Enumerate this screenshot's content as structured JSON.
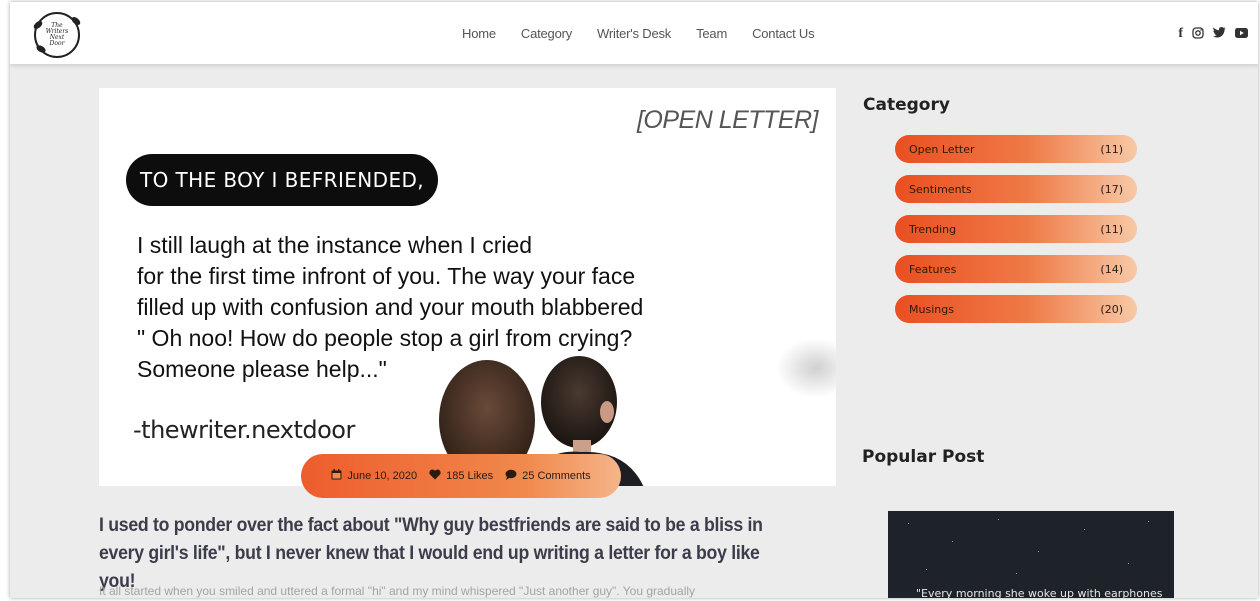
{
  "brand": {
    "logo_text": "The Writers Next Door"
  },
  "nav": {
    "items": [
      "Home",
      "Category",
      "Writer's Desk",
      "Team",
      "Contact Us"
    ]
  },
  "social": [
    {
      "icon": "facebook-icon",
      "glyph": "f"
    },
    {
      "icon": "instagram-icon",
      "glyph": "◎"
    },
    {
      "icon": "twitter-icon",
      "glyph": "🐦"
    },
    {
      "icon": "youtube-icon",
      "glyph": "▶"
    }
  ],
  "hero": {
    "tag": "[OPEN LETTER]",
    "heading": "TO THE BOY I BEFRIENDED,",
    "lines": [
      "I still laugh at the instance when I cried",
      "for the first time infront of you. The way your face",
      "filled up with confusion and your mouth blabbered",
      "\" Oh noo! How do people stop a girl from crying?",
      "Someone please help...\""
    ],
    "signature": "-thewriter.nextdoor"
  },
  "meta": {
    "date": "June 10, 2020",
    "likes": "185 Likes",
    "comments": "25 Comments"
  },
  "post": {
    "title": "I used to ponder over the fact about \"Why guy bestfriends are said to be a bliss in every girl's life\", but I never knew that I would end up writing a letter for a boy like you!",
    "excerpt": "It all started when you smiled and uttered a formal \"hi\" and my mind whispered \"Just another guy\". You gradually"
  },
  "sidebar": {
    "category_heading": "Category",
    "categories": [
      {
        "name": "Open Letter",
        "count": "(11)"
      },
      {
        "name": "Sentiments",
        "count": "(17)"
      },
      {
        "name": "Trending",
        "count": "(11)"
      },
      {
        "name": "Features",
        "count": "(14)"
      },
      {
        "name": "Musings",
        "count": "(20)"
      }
    ],
    "popular_heading": "Popular Post",
    "popular_caption": "\"Every morning she woke up with earphones"
  },
  "colors": {
    "accent": "#ed5c2c",
    "accent_light": "#f5b48a",
    "title_text": "#3c3c4a"
  }
}
